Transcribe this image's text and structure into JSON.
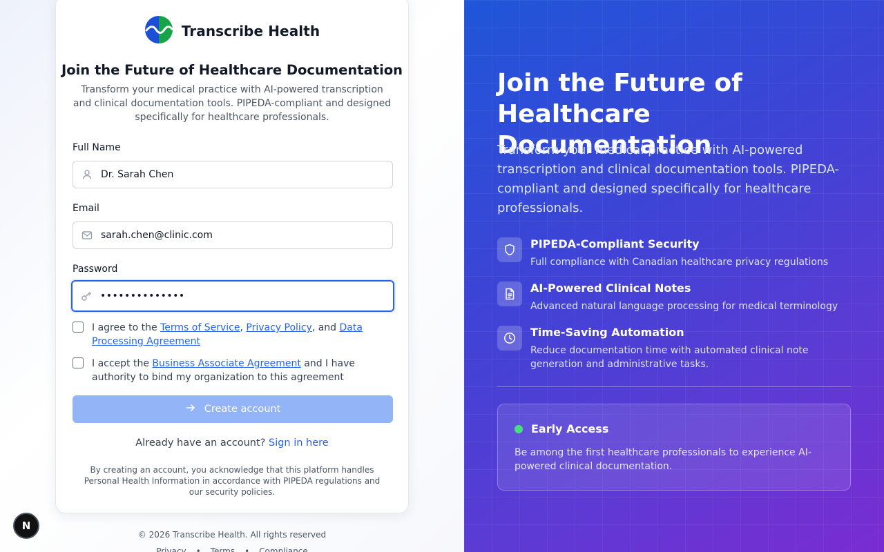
{
  "brand": {
    "name": "Transcribe Health"
  },
  "form": {
    "title": "Join the Future of Healthcare Documentation",
    "subtitle": "Transform your medical practice with AI-powered transcription and clinical documentation tools. PIPEDA-compliant and designed specifically for healthcare professionals.",
    "full_name": {
      "label": "Full Name",
      "value": "Dr. Sarah Chen",
      "icon": "user-icon"
    },
    "email": {
      "label": "Email",
      "value": "sarah.chen@clinic.com",
      "icon": "mail-icon"
    },
    "password": {
      "label": "Password",
      "value": "••••••••••••••",
      "icon": "key-icon"
    },
    "agree_terms": {
      "prefix": "I agree to the ",
      "terms_link": "Terms of Service",
      "sep1": ", ",
      "privacy_link": "Privacy Policy",
      "sep2": ", and ",
      "dpa_link": "Data Processing Agreement",
      "checked": false
    },
    "accept_baa": {
      "prefix": "I accept the ",
      "baa_link": "Business Associate Agreement",
      "suffix": " and I have authority to bind my organization to this agreement",
      "checked": false
    },
    "submit_label": "Create account",
    "signin_prompt": "Already have an account?",
    "signin_link": "Sign in here",
    "disclaimer": "By creating an account, you acknowledge that this platform handles Personal Health Information in accordance with PIPEDA regulations and our security policies."
  },
  "footer": {
    "copyright": "© 2026 Transcribe Health. All rights reserved",
    "links": [
      "Privacy",
      "Terms",
      "Compliance"
    ],
    "separator": "•"
  },
  "dev_badge": {
    "letter": "N"
  },
  "hero": {
    "title": "Join the Future of Healthcare Documentation",
    "subtitle": "Transform your medical practice with AI-powered transcription and clinical documentation tools. PIPEDA-compliant and designed specifically for healthcare professionals.",
    "features": [
      {
        "icon": "shield-icon",
        "title": "PIPEDA-Compliant Security",
        "desc": "Full compliance with Canadian healthcare privacy regulations"
      },
      {
        "icon": "document-icon",
        "title": "AI-Powered Clinical Notes",
        "desc": "Advanced natural language processing for medical terminology"
      },
      {
        "icon": "clock-icon",
        "title": "Time-Saving Automation",
        "desc": "Reduce documentation time with automated clinical note generation and administrative tasks."
      }
    ],
    "early_access": {
      "title": "Early Access",
      "desc": "Be among the first healthcare professionals to experience AI-powered clinical documentation."
    }
  },
  "colors": {
    "accent": "#2563eb",
    "button_disabled": "#93b4f7",
    "status_dot": "#4ade80",
    "logo_blue": "#1d4ed8",
    "logo_green": "#16a34a"
  }
}
